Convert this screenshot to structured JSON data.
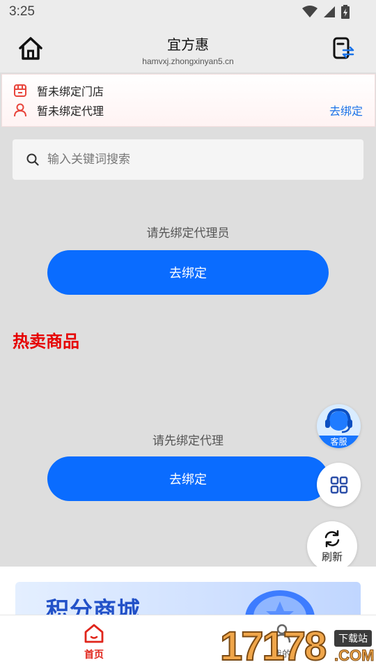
{
  "status_bar": {
    "time": "3:25"
  },
  "header": {
    "title": "宜方惠",
    "url": "hamvxj.zhongxinyan5.cn"
  },
  "bind_panel": {
    "store_text": "暂未绑定门店",
    "agent_text": "暂未绑定代理",
    "bind_link": "去绑定"
  },
  "search": {
    "placeholder": "输入关键词搜索"
  },
  "section1": {
    "hint": "请先绑定代理员",
    "button": "去绑定"
  },
  "hot": {
    "title": "热卖商品"
  },
  "section2": {
    "hint": "请先绑定代理",
    "button": "去绑定"
  },
  "floats": {
    "service_label": "客服",
    "refresh_label": "刷新"
  },
  "banner": {
    "text": "积分商城"
  },
  "tabbar": {
    "home": "首页",
    "me": "我的"
  },
  "watermark": {
    "number": "17178",
    "tag": "下载站",
    "suffix": ".COM"
  },
  "colors": {
    "primary": "#0a6cff",
    "hot": "#e60000",
    "tab_active": "#e0251b",
    "link": "#1a73e8"
  }
}
